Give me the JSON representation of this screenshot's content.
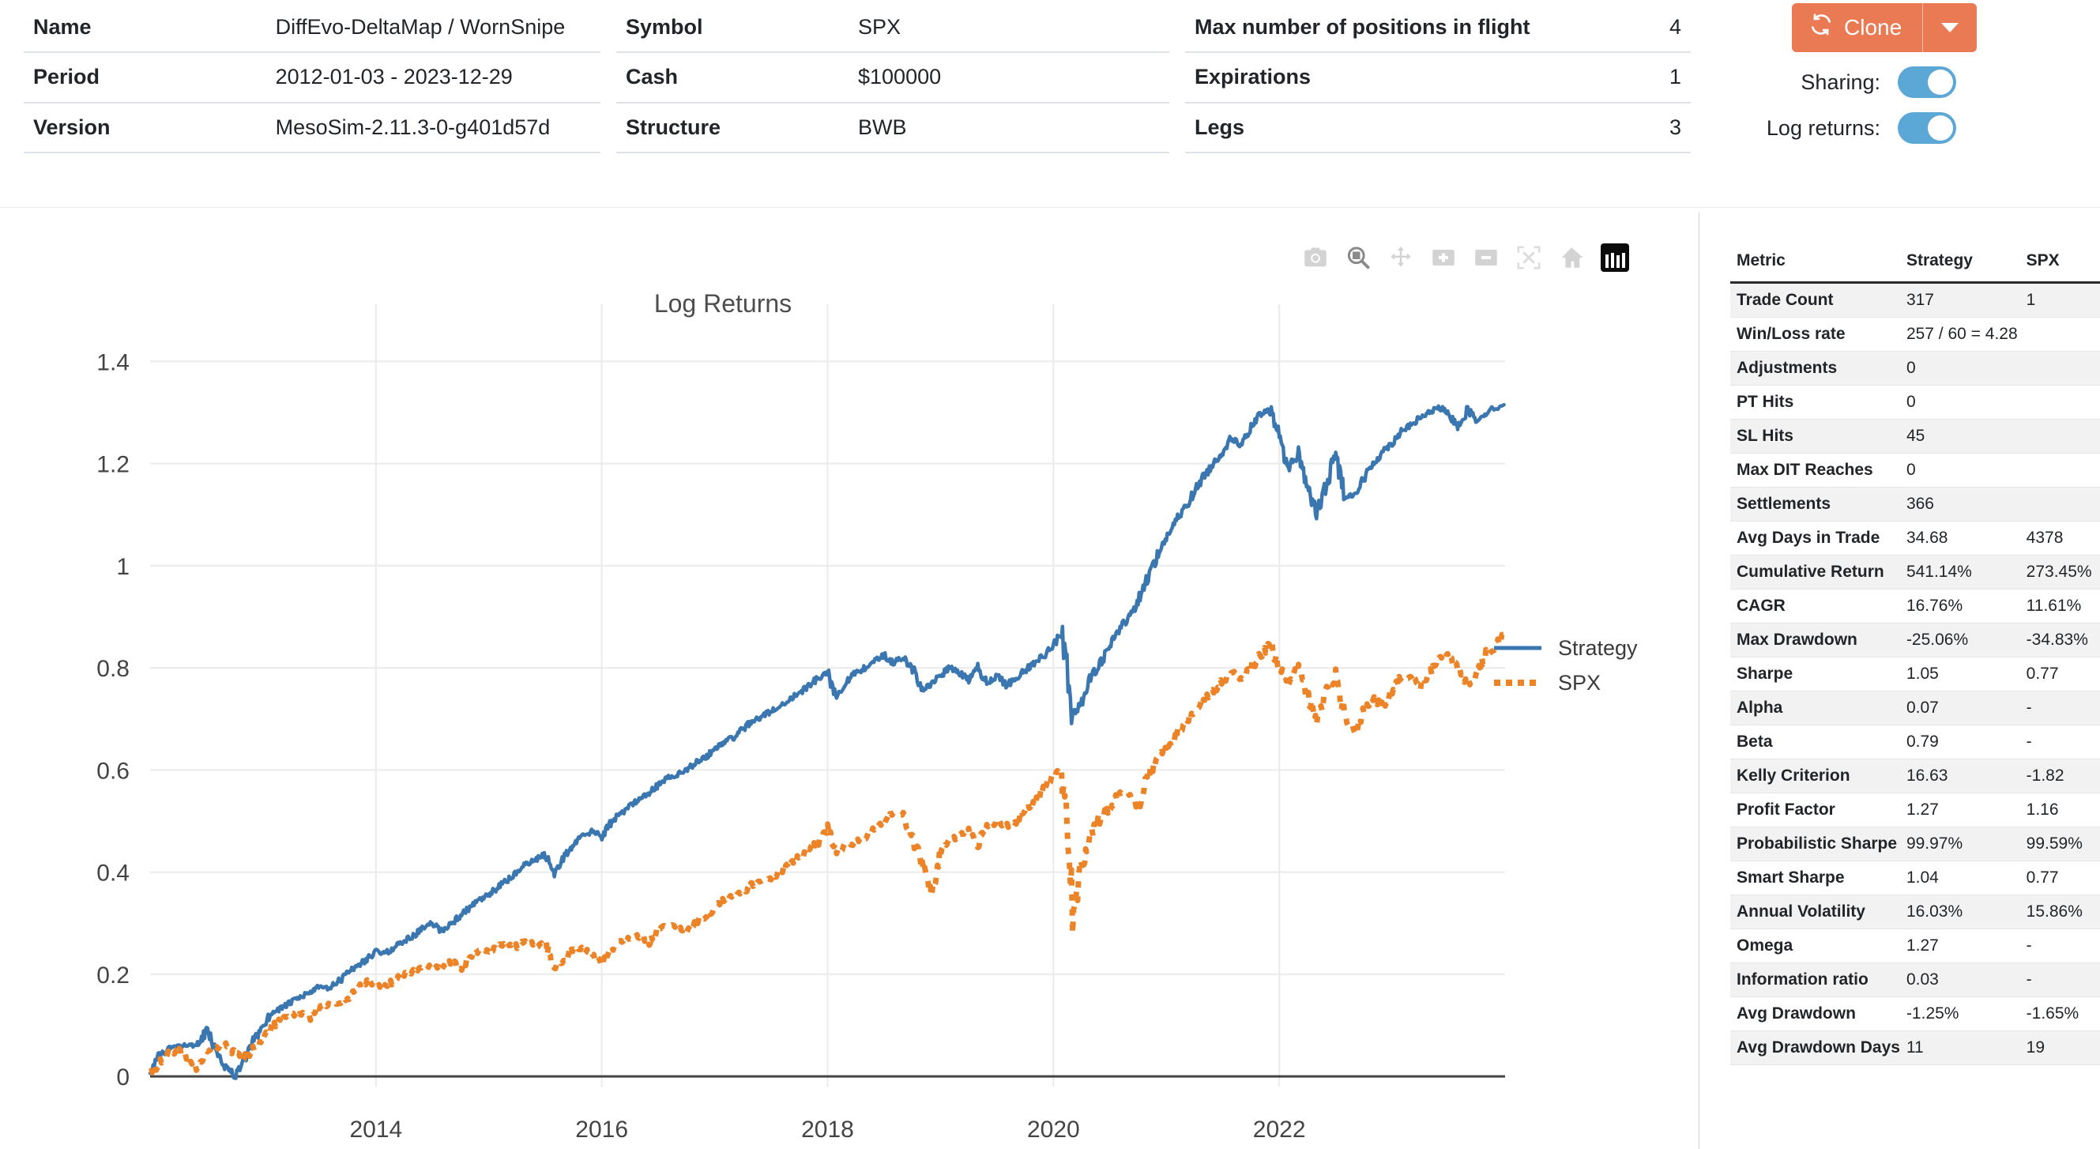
{
  "header": {
    "col1": [
      {
        "key": "Name",
        "value": "DiffEvo-DeltaMap / WornSnipe"
      },
      {
        "key": "Period",
        "value": "2012-01-03 - 2023-12-29"
      },
      {
        "key": "Version",
        "value": "MesoSim-2.11.3-0-g401d57d"
      }
    ],
    "col2": [
      {
        "key": "Symbol",
        "value": "SPX"
      },
      {
        "key": "Cash",
        "value": "$100000"
      },
      {
        "key": "Structure",
        "value": "BWB"
      }
    ],
    "col3": [
      {
        "key": "Max number of positions in flight",
        "value": "4"
      },
      {
        "key": "Expirations",
        "value": "1"
      },
      {
        "key": "Legs",
        "value": "3"
      }
    ],
    "clone_label": "Clone",
    "clone_color": "#ea7a54",
    "toggles": [
      {
        "label": "Sharing:",
        "on": true
      },
      {
        "label": "Log returns:",
        "on": true
      }
    ],
    "toggle_color": "#5ba7d6"
  },
  "modebar": {
    "buttons": [
      "camera-icon",
      "zoom-box-icon",
      "pan-arrows-icon",
      "zoom-in-icon",
      "zoom-out-icon",
      "autoscale-icon",
      "home-reset-icon",
      "plotly-logo-icon"
    ]
  },
  "chart_data": {
    "type": "line",
    "title": "Log Returns",
    "xlabel": "",
    "ylabel": "",
    "grid": true,
    "legend_position": "right",
    "xlim": [
      2012.0,
      2024.0
    ],
    "ylim": [
      -0.02,
      1.45
    ],
    "xticks": [
      "2014",
      "2016",
      "2018",
      "2020",
      "2022"
    ],
    "xtick_values": [
      2014,
      2016,
      2018,
      2020,
      2022
    ],
    "yticks": [
      "0",
      "0.2",
      "0.4",
      "0.6",
      "0.8",
      "1",
      "1.2",
      "1.4"
    ],
    "ytick_values": [
      0,
      0.2,
      0.4,
      0.6,
      0.8,
      1,
      1.2,
      1.4
    ],
    "colors": {
      "Strategy": "#3a76af",
      "SPX": "#ec8327"
    },
    "x": [
      2012.0,
      2012.08,
      2012.17,
      2012.25,
      2012.33,
      2012.42,
      2012.5,
      2012.58,
      2012.67,
      2012.75,
      2012.83,
      2012.92,
      2013.0,
      2013.08,
      2013.17,
      2013.25,
      2013.33,
      2013.42,
      2013.5,
      2013.58,
      2013.67,
      2013.75,
      2013.83,
      2013.92,
      2014.0,
      2014.08,
      2014.17,
      2014.25,
      2014.33,
      2014.42,
      2014.5,
      2014.58,
      2014.67,
      2014.75,
      2014.83,
      2014.92,
      2015.0,
      2015.08,
      2015.17,
      2015.25,
      2015.33,
      2015.42,
      2015.5,
      2015.58,
      2015.67,
      2015.75,
      2015.83,
      2015.92,
      2016.0,
      2016.08,
      2016.17,
      2016.25,
      2016.33,
      2016.42,
      2016.5,
      2016.58,
      2016.67,
      2016.75,
      2016.83,
      2016.92,
      2017.0,
      2017.08,
      2017.17,
      2017.25,
      2017.33,
      2017.42,
      2017.5,
      2017.58,
      2017.67,
      2017.75,
      2017.83,
      2017.92,
      2018.0,
      2018.08,
      2018.17,
      2018.25,
      2018.33,
      2018.42,
      2018.5,
      2018.58,
      2018.67,
      2018.75,
      2018.83,
      2018.92,
      2019.0,
      2019.08,
      2019.17,
      2019.25,
      2019.33,
      2019.42,
      2019.5,
      2019.58,
      2019.67,
      2019.75,
      2019.83,
      2019.92,
      2020.0,
      2020.08,
      2020.17,
      2020.25,
      2020.33,
      2020.42,
      2020.5,
      2020.58,
      2020.67,
      2020.75,
      2020.83,
      2020.92,
      2021.0,
      2021.08,
      2021.17,
      2021.25,
      2021.33,
      2021.42,
      2021.5,
      2021.58,
      2021.67,
      2021.75,
      2021.83,
      2021.92,
      2022.0,
      2022.08,
      2022.17,
      2022.25,
      2022.33,
      2022.42,
      2022.5,
      2022.58,
      2022.67,
      2022.75,
      2022.83,
      2022.92,
      2023.0,
      2023.08,
      2023.17,
      2023.25,
      2023.33,
      2023.42,
      2023.5,
      2023.58,
      2023.67,
      2023.75,
      2023.83,
      2023.99
    ],
    "series": [
      {
        "name": "Strategy",
        "style": "solid",
        "values": [
          0.01,
          0.04,
          0.055,
          0.06,
          0.062,
          0.058,
          0.09,
          0.055,
          0.02,
          0.0,
          0.03,
          0.07,
          0.1,
          0.125,
          0.135,
          0.145,
          0.155,
          0.165,
          0.175,
          0.172,
          0.185,
          0.205,
          0.215,
          0.23,
          0.245,
          0.24,
          0.255,
          0.265,
          0.275,
          0.29,
          0.3,
          0.285,
          0.3,
          0.315,
          0.33,
          0.345,
          0.355,
          0.37,
          0.385,
          0.4,
          0.415,
          0.425,
          0.435,
          0.4,
          0.43,
          0.455,
          0.47,
          0.48,
          0.47,
          0.495,
          0.515,
          0.53,
          0.545,
          0.555,
          0.57,
          0.585,
          0.59,
          0.6,
          0.615,
          0.625,
          0.64,
          0.655,
          0.665,
          0.68,
          0.695,
          0.705,
          0.715,
          0.725,
          0.74,
          0.75,
          0.765,
          0.78,
          0.79,
          0.745,
          0.775,
          0.79,
          0.8,
          0.815,
          0.825,
          0.81,
          0.82,
          0.8,
          0.755,
          0.77,
          0.785,
          0.8,
          0.79,
          0.775,
          0.8,
          0.77,
          0.785,
          0.765,
          0.78,
          0.795,
          0.81,
          0.825,
          0.845,
          0.87,
          0.71,
          0.73,
          0.78,
          0.81,
          0.84,
          0.875,
          0.9,
          0.93,
          0.975,
          1.02,
          1.055,
          1.085,
          1.115,
          1.145,
          1.175,
          1.2,
          1.225,
          1.25,
          1.235,
          1.27,
          1.295,
          1.305,
          1.255,
          1.19,
          1.22,
          1.155,
          1.1,
          1.16,
          1.22,
          1.135,
          1.14,
          1.17,
          1.2,
          1.225,
          1.24,
          1.265,
          1.275,
          1.29,
          1.3,
          1.31,
          1.295,
          1.275,
          1.305,
          1.285,
          1.3,
          1.315
        ]
      },
      {
        "name": "SPX",
        "style": "dotted",
        "values": [
          0.005,
          0.025,
          0.045,
          0.05,
          0.035,
          0.015,
          0.045,
          0.055,
          0.06,
          0.045,
          0.035,
          0.055,
          0.07,
          0.095,
          0.115,
          0.12,
          0.125,
          0.115,
          0.135,
          0.14,
          0.145,
          0.155,
          0.17,
          0.185,
          0.18,
          0.175,
          0.19,
          0.2,
          0.205,
          0.215,
          0.215,
          0.21,
          0.225,
          0.21,
          0.235,
          0.245,
          0.245,
          0.255,
          0.26,
          0.255,
          0.265,
          0.255,
          0.26,
          0.215,
          0.23,
          0.25,
          0.25,
          0.235,
          0.22,
          0.245,
          0.265,
          0.27,
          0.275,
          0.265,
          0.29,
          0.295,
          0.295,
          0.285,
          0.3,
          0.315,
          0.33,
          0.345,
          0.355,
          0.36,
          0.375,
          0.385,
          0.39,
          0.4,
          0.415,
          0.43,
          0.445,
          0.46,
          0.485,
          0.44,
          0.455,
          0.455,
          0.47,
          0.485,
          0.5,
          0.515,
          0.51,
          0.47,
          0.42,
          0.365,
          0.435,
          0.46,
          0.475,
          0.48,
          0.455,
          0.49,
          0.5,
          0.49,
          0.5,
          0.525,
          0.535,
          0.565,
          0.59,
          0.6,
          0.305,
          0.41,
          0.47,
          0.51,
          0.525,
          0.555,
          0.555,
          0.53,
          0.585,
          0.62,
          0.64,
          0.665,
          0.695,
          0.715,
          0.735,
          0.755,
          0.775,
          0.79,
          0.78,
          0.8,
          0.825,
          0.845,
          0.8,
          0.775,
          0.8,
          0.745,
          0.7,
          0.755,
          0.785,
          0.7,
          0.675,
          0.715,
          0.74,
          0.725,
          0.755,
          0.78,
          0.78,
          0.765,
          0.79,
          0.82,
          0.825,
          0.795,
          0.77,
          0.785,
          0.825,
          0.865
        ]
      }
    ]
  },
  "metrics": {
    "columns": [
      "Metric",
      "Strategy",
      "SPX"
    ],
    "rows": [
      {
        "name": "Trade Count",
        "strategy": "317",
        "spx": "1"
      },
      {
        "name": "Win/Loss rate",
        "strategy": "257 / 60 = 4.28",
        "spx": ""
      },
      {
        "name": "Adjustments",
        "strategy": "0",
        "spx": ""
      },
      {
        "name": "PT Hits",
        "strategy": "0",
        "spx": ""
      },
      {
        "name": "SL Hits",
        "strategy": "45",
        "spx": ""
      },
      {
        "name": "Max DIT Reaches",
        "strategy": "0",
        "spx": ""
      },
      {
        "name": "Settlements",
        "strategy": "366",
        "spx": ""
      },
      {
        "name": "Avg Days in Trade",
        "strategy": "34.68",
        "spx": "4378"
      },
      {
        "name": "Cumulative Return",
        "strategy": "541.14%",
        "spx": "273.45%"
      },
      {
        "name": "CAGR",
        "strategy": "16.76%",
        "spx": "11.61%"
      },
      {
        "name": "Max Drawdown",
        "strategy": "-25.06%",
        "spx": "-34.83%"
      },
      {
        "name": "Sharpe",
        "strategy": "1.05",
        "spx": "0.77"
      },
      {
        "name": "Alpha",
        "strategy": "0.07",
        "spx": "-"
      },
      {
        "name": "Beta",
        "strategy": "0.79",
        "spx": "-"
      },
      {
        "name": "Kelly Criterion",
        "strategy": "16.63",
        "spx": "-1.82"
      },
      {
        "name": "Profit Factor",
        "strategy": "1.27",
        "spx": "1.16"
      },
      {
        "name": "Probabilistic Sharpe",
        "strategy": "99.97%",
        "spx": "99.59%"
      },
      {
        "name": "Smart Sharpe",
        "strategy": "1.04",
        "spx": "0.77"
      },
      {
        "name": "Annual Volatility",
        "strategy": "16.03%",
        "spx": "15.86%"
      },
      {
        "name": "Omega",
        "strategy": "1.27",
        "spx": "-"
      },
      {
        "name": "Information ratio",
        "strategy": "0.03",
        "spx": "-"
      },
      {
        "name": "Avg Drawdown",
        "strategy": "-1.25%",
        "spx": "-1.65%"
      },
      {
        "name": "Avg Drawdown Days",
        "strategy": "11",
        "spx": "19"
      }
    ]
  }
}
